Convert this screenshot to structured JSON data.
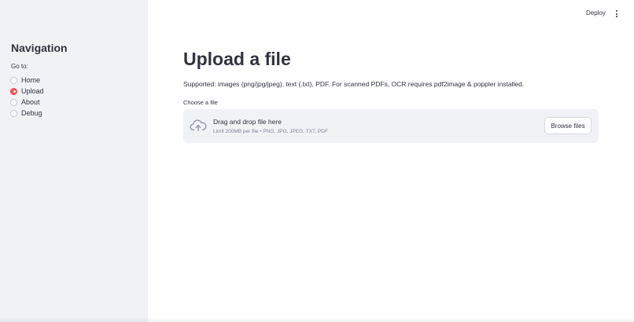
{
  "sidebar": {
    "title": "Navigation",
    "radio_label": "Go to:",
    "options": [
      {
        "label": "Home",
        "selected": false
      },
      {
        "label": "Upload",
        "selected": true
      },
      {
        "label": "About",
        "selected": false
      },
      {
        "label": "Debug",
        "selected": false
      }
    ]
  },
  "header": {
    "deploy_label": "Deploy",
    "menu_icon": "kebab-menu-icon"
  },
  "main": {
    "title": "Upload a file",
    "supported_text": "Supported: images (png/jpg/jpeg), text (.txt), PDF. For scanned PDFs, OCR requires pdf2image & poppler installed.",
    "uploader": {
      "label": "Choose a file",
      "drop_title": "Drag and drop file here",
      "limit_text": "Limit 200MB per file • PNG, JPG, JPEG, TXT, PDF",
      "browse_label": "Browse files",
      "icon": "cloud-upload-icon"
    }
  },
  "colors": {
    "accent": "#ff4b4b",
    "sidebar_bg": "#f0f2f6",
    "text": "#31333f"
  }
}
